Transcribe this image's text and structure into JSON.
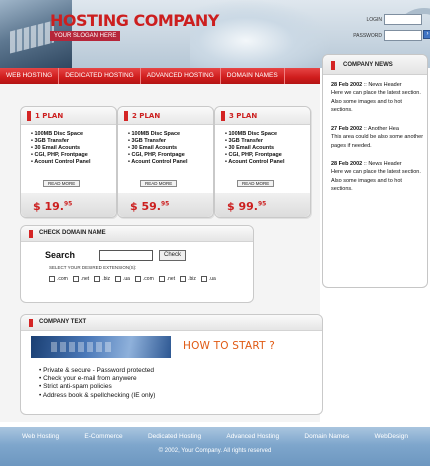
{
  "header": {
    "title": "HOSTING COMPANY",
    "slogan": "YOUR SLOGAN HERE",
    "login_label": "LOGIN",
    "password_label": "PASSWORD",
    "go_icon": "arrow-right-icon"
  },
  "nav": [
    "WEB HOSTING",
    "DEDICATED HOSTING",
    "ADVANCED HOSTING",
    "DOMAIN NAMES"
  ],
  "plans": [
    {
      "title": "1 PLAN",
      "features": [
        "100MB Disc Space",
        "3GB Transfer",
        "30 Email Acounts",
        "CGI, PHP, Frontpage",
        "Acount Control Panel"
      ],
      "more": "READ MORE",
      "price": "$ 19.",
      "cents": "95"
    },
    {
      "title": "2 PLAN",
      "features": [
        "100MB Disc Space",
        "3GB Transfer",
        "30 Email Acounts",
        "CGI, PHP, Frontpage",
        "Acount Control Panel"
      ],
      "more": "READ MORE",
      "price": "$ 59.",
      "cents": "95"
    },
    {
      "title": "3 PLAN",
      "features": [
        "100MB Disc Space",
        "3GB Transfer",
        "30 Email Acounts",
        "CGI, PHP, Frontpage",
        "Acount Control Panel"
      ],
      "more": "READ MORE",
      "price": "$ 99.",
      "cents": "95"
    }
  ],
  "domain": {
    "title": "CHECK DOMAIN NAME",
    "search_label": "Search",
    "check_label": "Check",
    "select_text": "SELECT YOUR DESIRED EXTENSION(S):",
    "extensions": [
      ".com",
      ".net",
      ".biz",
      ".ua",
      ".com",
      ".net",
      ".biz",
      ".ua"
    ]
  },
  "company": {
    "title": "COMPANY TEXT",
    "how_to_start": "HOW TO START ?",
    "bullets": [
      "Private & secure - Password protected",
      "Check your e-mail from anywere",
      "Strict anti-spam policies",
      "Address book & spellchecking (IE only)"
    ]
  },
  "news": {
    "title": "COMPANY NEWS",
    "items": [
      {
        "date": "28 Feb 2002",
        "sep": " :: ",
        "header": "News Header",
        "text": "Here we can place the latest section. Also some images and to hot sections."
      },
      {
        "date": "27 Feb 2002",
        "sep": " :: ",
        "header": "Another Hea",
        "text": "This area could be also some another pages if needed."
      },
      {
        "date": "28 Feb 2002",
        "sep": " :: ",
        "header": "News Header",
        "text": "Here we can place the latest section. Also some images and to hot sections."
      }
    ]
  },
  "footer": {
    "links": [
      "Web Hosting",
      "E-Commerce",
      "Dedicated Hosting",
      "Advanced Hosting",
      "Domain Names",
      "WebDesign"
    ],
    "copyright": "© 2002, Your Company. All rights reserved"
  },
  "colors": {
    "accent_red": "#cc1f1f",
    "nav_red": "#d42424",
    "orange": "#e05a14",
    "footer_blue": "#7ea6cc"
  }
}
